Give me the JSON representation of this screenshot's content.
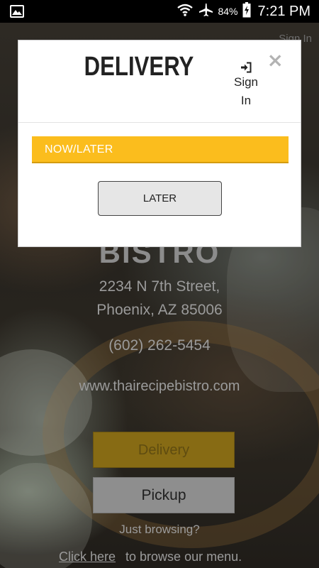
{
  "status_bar": {
    "battery": "84%",
    "time": "7:21 PM"
  },
  "background": {
    "brand_partial": "BISTRO",
    "sign_in_label": "Sign In",
    "address_line1": "2234 N 7th Street,",
    "address_line2": "Phoenix, AZ 85006",
    "phone": "(602) 262-5454",
    "website": "www.thairecipebistro.com",
    "delivery_button": "Delivery",
    "pickup_button": "Pickup",
    "browsing_text": "Just browsing?",
    "click_here": "Click here",
    "browse_menu_text": "to browse our menu."
  },
  "modal": {
    "title": "DELIVERY",
    "sign_in": "Sign In",
    "close_icon": "×",
    "now_later_label": "NOW/LATER",
    "later_button": "LATER"
  },
  "colors": {
    "accent": "#fbbd1d",
    "modal_bg": "#ffffff",
    "button_bg": "#e6e6e6"
  },
  "icons": {
    "gallery": "image-icon",
    "wifi": "wifi-icon",
    "airplane": "airplane-icon",
    "battery": "battery-charging-icon",
    "sign_in": "sign-in-icon",
    "close": "close-icon"
  }
}
